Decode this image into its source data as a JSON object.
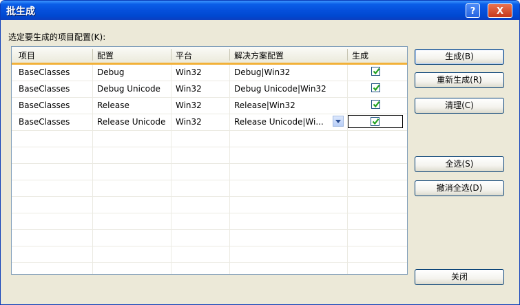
{
  "window": {
    "title": "批生成",
    "help_label": "?",
    "close_label": "X"
  },
  "prompt": "选定要生成的项目配置(K):",
  "columns": [
    "项目",
    "配置",
    "平台",
    "解决方案配置",
    "生成"
  ],
  "rows": [
    {
      "project": "BaseClasses",
      "config": "Debug",
      "platform": "Win32",
      "solution": "Debug|Win32",
      "build": true
    },
    {
      "project": "BaseClasses",
      "config": "Debug Unicode",
      "platform": "Win32",
      "solution": "Debug Unicode|Win32",
      "build": true
    },
    {
      "project": "BaseClasses",
      "config": "Release",
      "platform": "Win32",
      "solution": "Release|Win32",
      "build": true
    },
    {
      "project": "BaseClasses",
      "config": "Release Unicode",
      "platform": "Win32",
      "solution": "Release Unicode|Wi...",
      "build": true
    }
  ],
  "buttons": {
    "build": "生成(B)",
    "rebuild": "重新生成(R)",
    "clean": "清理(C)",
    "select_all": "全选(S)",
    "deselect_all": "撤消全选(D)",
    "close": "关闭"
  },
  "colors": {
    "title_bar": "#0550dc",
    "header_underline": "#f2b138",
    "checkbox_border": "#1c5180",
    "check_mark": "#21a121"
  }
}
